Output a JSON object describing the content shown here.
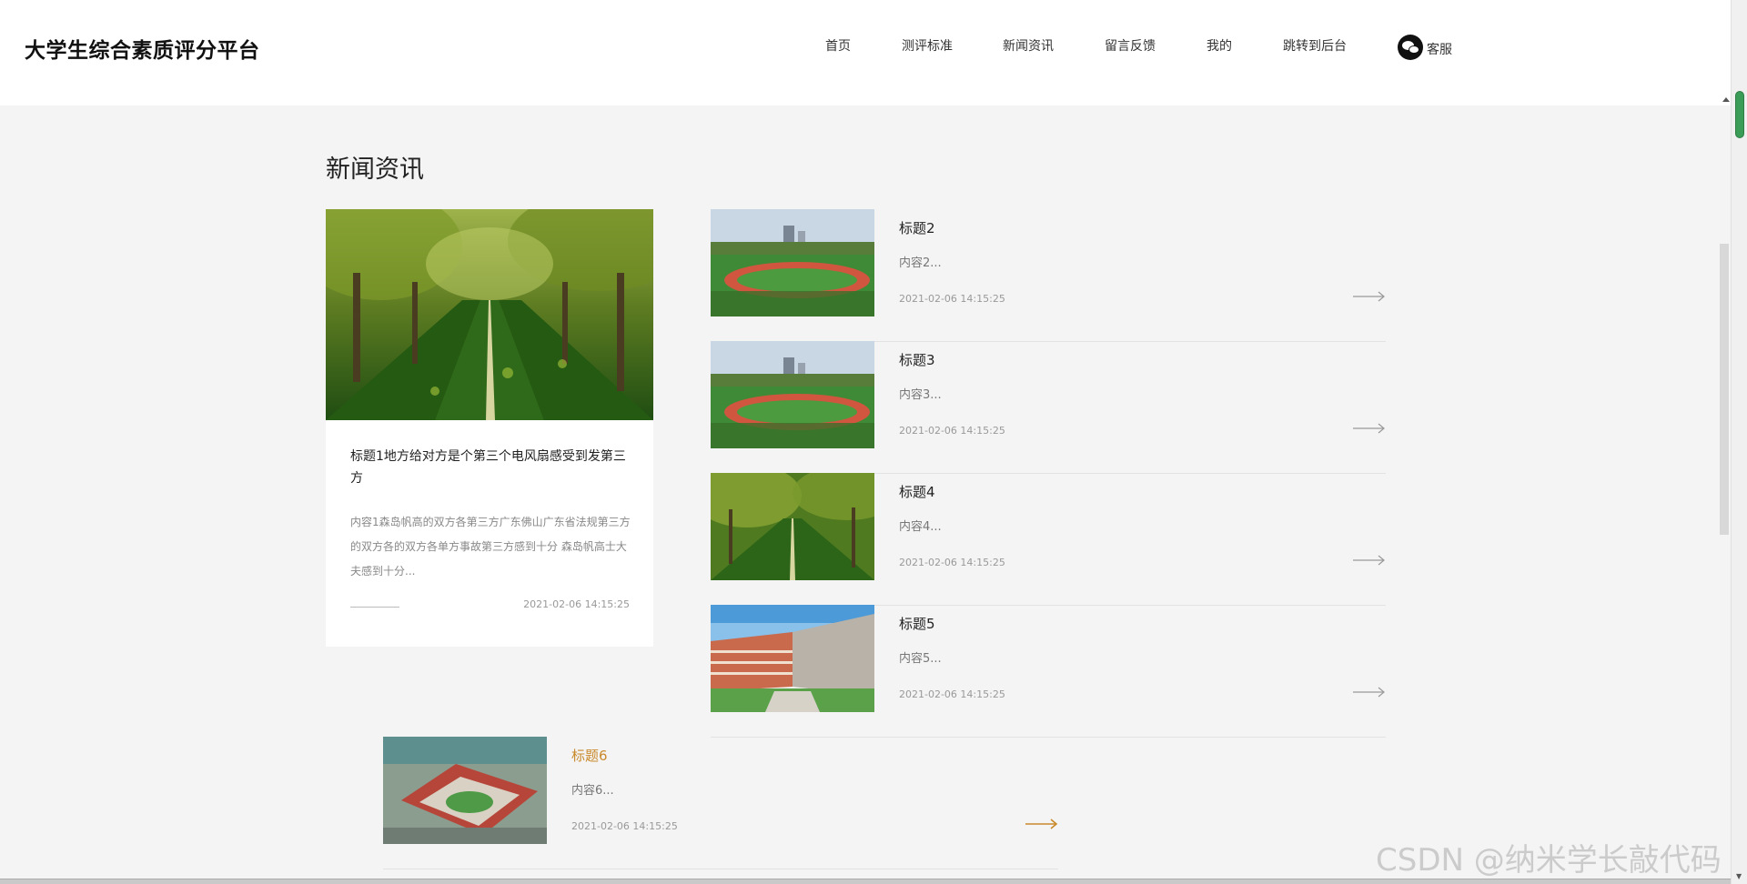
{
  "header": {
    "brand": "大学生综合素质评分平台",
    "nav": [
      "首页",
      "测评标准",
      "新闻资讯",
      "留言反馈",
      "我的",
      "跳转到后台"
    ],
    "service_label": "客服"
  },
  "section": {
    "title": "新闻资讯"
  },
  "featured": {
    "title": "标题1地方给对方是个第三个电风扇感受到发第三方",
    "summary": "内容1森岛帆高的双方各第三方广东佛山广东省法规第三方的双方各的双方各单方事故第三方感到十分 森岛帆高士大夫感到十分...",
    "date": "2021-02-06 14:15:25"
  },
  "news": [
    {
      "title": "标题2",
      "desc": "内容2...",
      "date": "2021-02-06 14:15:25",
      "image": "stadium-track"
    },
    {
      "title": "标题3",
      "desc": "内容3...",
      "date": "2021-02-06 14:15:25",
      "image": "stadium-track"
    },
    {
      "title": "标题4",
      "desc": "内容4...",
      "date": "2021-02-06 14:15:25",
      "image": "tree-road"
    },
    {
      "title": "标题5",
      "desc": "内容5...",
      "date": "2021-02-06 14:15:25",
      "image": "campus-building"
    },
    {
      "title": "标题6",
      "desc": "内容6...",
      "date": "2021-02-06 14:15:25",
      "image": "campus-aerial"
    }
  ],
  "colors": {
    "accent": "#c98a2c",
    "background": "#f4f4f4",
    "text": "#333333"
  },
  "watermark": "CSDN @纳米学长敲代码"
}
